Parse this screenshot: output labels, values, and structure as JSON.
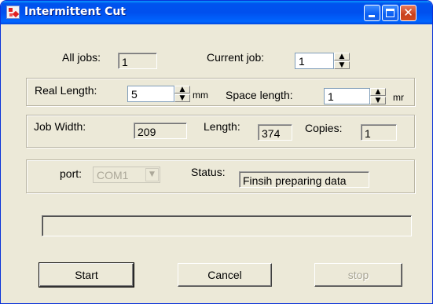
{
  "window": {
    "title": "Intermittent Cut"
  },
  "jobs": {
    "all_jobs_label": "All jobs:",
    "all_jobs_value": "1",
    "current_job_label": "Current job:",
    "current_job_value": "1"
  },
  "lengths": {
    "real_length_label": "Real Length:",
    "real_length_value": "5",
    "real_length_unit": "mm",
    "space_length_label": "Space length:",
    "space_length_value": "1",
    "space_length_unit": "mr"
  },
  "job": {
    "width_label": "Job Width:",
    "width_value": "209",
    "length_label": "Length:",
    "length_value": "374",
    "copies_label": "Copies:",
    "copies_value": "1"
  },
  "connection": {
    "port_label": "port:",
    "port_value": "COM1",
    "status_label": "Status:",
    "status_value": "Finsih preparing data"
  },
  "progress": {
    "fraction": 0
  },
  "buttons": {
    "start": "Start",
    "cancel": "Cancel",
    "stop": "stop"
  },
  "icons": {
    "app": "app-icon",
    "minimize": "minimize-icon",
    "maximize": "maximize-icon",
    "close": "close-icon",
    "spin_up": "spin-up-icon",
    "spin_down": "spin-down-icon",
    "dropdown": "chevron-down-icon"
  },
  "colors": {
    "titlebar": "#0054e3",
    "window_face": "#ece9d8",
    "progress_fill": "#2a64d8"
  }
}
